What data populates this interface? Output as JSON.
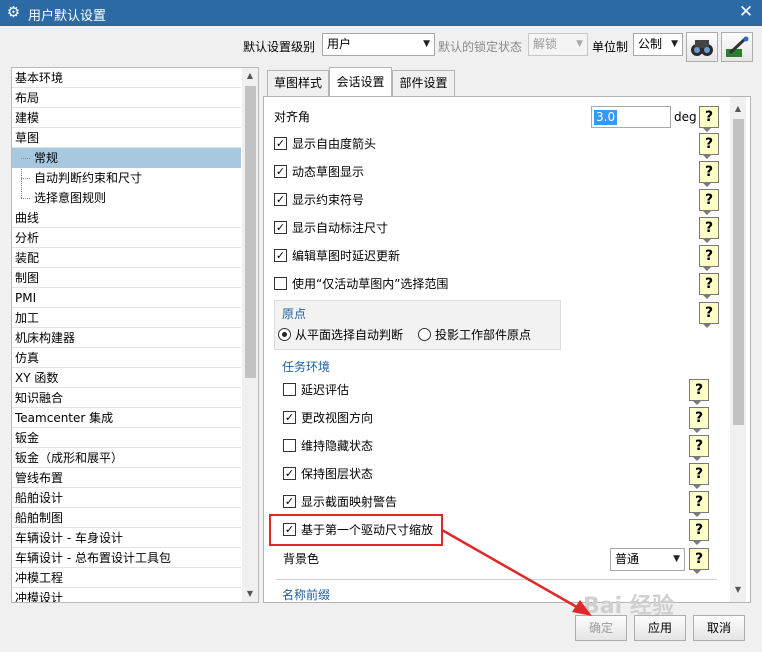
{
  "window": {
    "title": "用户默认设置",
    "close_glyph": "✕"
  },
  "toolbar": {
    "level_label": "默认设置级别",
    "level_value": "用户",
    "lock_label": "默认的锁定状态",
    "lock_value": "解锁",
    "unit_label": "单位制",
    "unit_value": "公制"
  },
  "tree": {
    "items": [
      {
        "label": "基本环境"
      },
      {
        "label": "布局"
      },
      {
        "label": "建模"
      },
      {
        "label": "草图"
      },
      {
        "label": "常规",
        "child": true,
        "selected": true
      },
      {
        "label": "自动判断约束和尺寸",
        "child": true
      },
      {
        "label": "选择意图规则",
        "child": true
      },
      {
        "label": "曲线"
      },
      {
        "label": "分析"
      },
      {
        "label": "装配"
      },
      {
        "label": "制图"
      },
      {
        "label": "PMI"
      },
      {
        "label": "加工"
      },
      {
        "label": "机床构建器"
      },
      {
        "label": "仿真"
      },
      {
        "label": "XY 函数"
      },
      {
        "label": "知识融合"
      },
      {
        "label": "Teamcenter 集成"
      },
      {
        "label": "钣金"
      },
      {
        "label": "钣金（成形和展平）"
      },
      {
        "label": "管线布置"
      },
      {
        "label": "船舶设计"
      },
      {
        "label": "船舶制图"
      },
      {
        "label": "车辆设计 - 车身设计"
      },
      {
        "label": "车辆设计 - 总布置设计工具包"
      },
      {
        "label": "冲模工程"
      },
      {
        "label": "冲模设计"
      }
    ]
  },
  "tabs": [
    {
      "label": "草图样式"
    },
    {
      "label": "会话设置"
    },
    {
      "label": "部件设置"
    }
  ],
  "panel": {
    "snap_angle_label": "对齐角",
    "snap_angle_value": "3.0",
    "snap_angle_unit": "deg",
    "options": [
      {
        "label": "显示自由度箭头",
        "checked": true
      },
      {
        "label": "动态草图显示",
        "checked": true
      },
      {
        "label": "显示约束符号",
        "checked": true
      },
      {
        "label": "显示自动标注尺寸",
        "checked": true
      },
      {
        "label": "编辑草图时延迟更新",
        "checked": true
      },
      {
        "label": "使用“仅活动草图内”选择范围",
        "checked": false
      }
    ],
    "origin": {
      "title": "原点",
      "radio1": "从平面选择自动判断",
      "radio2": "投影工作部件原点",
      "selected": "radio1"
    },
    "task_env": {
      "title": "任务环境",
      "options": [
        {
          "label": "延迟评估",
          "checked": false
        },
        {
          "label": "更改视图方向",
          "checked": true
        },
        {
          "label": "维持隐藏状态",
          "checked": false
        },
        {
          "label": "保持图层状态",
          "checked": true
        },
        {
          "label": "显示截面映射警告",
          "checked": true
        },
        {
          "label": "基于第一个驱动尺寸缩放",
          "checked": true
        }
      ],
      "bg_label": "背景色",
      "bg_value": "普通"
    },
    "next_group": "名称前缀"
  },
  "buttons": {
    "ok": "确定",
    "apply": "应用",
    "cancel": "取消"
  },
  "watermark": "Bai 经验",
  "colors": {
    "titlebar": "#2b6aa5",
    "selection": "#a8c8e0",
    "annotation": "#e02828"
  }
}
